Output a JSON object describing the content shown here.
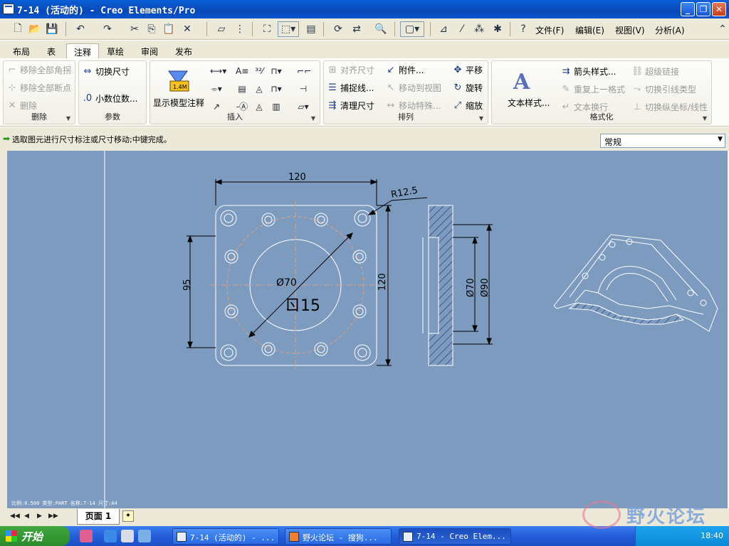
{
  "window": {
    "title": "7-14 (活动的) - Creo Elements/Pro",
    "min_glyph": "_",
    "max_glyph": "❐",
    "close_glyph": "✕"
  },
  "menus": [
    "文件(F)",
    "编辑(E)",
    "视图(V)",
    "分析(A)"
  ],
  "tabs": [
    "布局",
    "表",
    "注释",
    "草绘",
    "审阅",
    "发布"
  ],
  "active_tab": "注释",
  "ribbon": {
    "delete": {
      "label": "删除",
      "items": [
        "移除全部角拐",
        "移除全部断点",
        "删除"
      ]
    },
    "params": {
      "label": "参数",
      "items": [
        "切换尺寸",
        "小数位数..."
      ]
    },
    "insert": {
      "label": "插入",
      "big_button": "显示模型注释"
    },
    "arrange": {
      "label": "排列",
      "items": [
        "对齐尺寸",
        "捕捉线...",
        "清理尺寸",
        "附件...",
        "移动到视图",
        "移动特殊...",
        "平移",
        "旋转",
        "缩放"
      ]
    },
    "format": {
      "label": "格式化",
      "big_button": "文本样式...",
      "items": [
        "箭头样式...",
        "重复上一格式",
        "文本换行",
        "超级链接",
        "切换引线类型",
        "切换纵坐标/线性"
      ]
    }
  },
  "message": "选取图元进行尺寸标注或尺寸移动;中键完成。",
  "filter": {
    "value": "常规"
  },
  "drawing": {
    "dims": {
      "top": "120",
      "radius": "R12.5",
      "left": "95",
      "right": "120",
      "center": "Ø70",
      "sec1": "Ø70",
      "sec2": "Ø90"
    },
    "handwriting": "ㄖ15"
  },
  "sysinfo": "比例:0.500  类型:PART  名称:7-14  尺寸:A4",
  "sheet_tab": "页面 1",
  "taskbar": {
    "start": "开始",
    "tasks": [
      "7-14 (活动的) - ...",
      "野火论坛 - 搜狗...",
      "7-14 - Creo Elem..."
    ],
    "clock": "18:40"
  },
  "watermark": "野火论坛",
  "colors": {
    "canvas": "#7d9bbf",
    "line": "#ffffff",
    "dim": "#000000",
    "hatch": "#1a2a70"
  }
}
